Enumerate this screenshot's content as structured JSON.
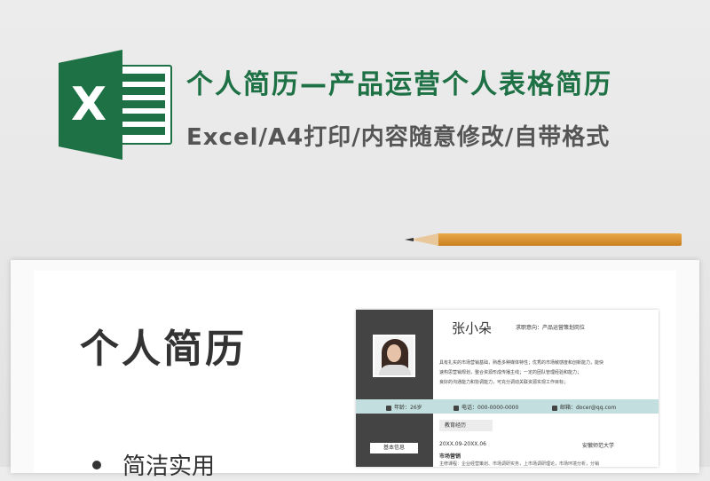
{
  "banner": {
    "title": "个人简历—产品运营个人表格简历",
    "subtitle": "Excel/A4打印/内容随意修改/自带格式",
    "logo_letter": "X",
    "brand_color": "#1e7145"
  },
  "slide": {
    "title": "个人简历",
    "bullet": "简洁实用"
  },
  "resume": {
    "name": "张小朵",
    "job_intent": "求职意向：产品运营策划岗位",
    "intro_lines": [
      "具有扎实的市场营销基础，熟悉多种媒体特性；优秀的市场敏感度和创新能力，能快",
      "速构思营销规划，整合资源形成传播主线；一定的团队管理经验和能力；",
      "良好的沟通能力和协调能力，可充分调动关联资源实现工作目标；"
    ],
    "age": "年龄：26岁",
    "phone": "电话：000-0000-0000",
    "email": "邮箱：docer@qq.com",
    "education_heading": "教育经历",
    "basic_info_heading": "基本信息",
    "edu_date": "20XX.09-20XX.06",
    "edu_school": "安徽师范大学",
    "edu_major": "市场营销",
    "edu_course": "主修课程：企业经营策划、市场调研实务，上市场调研理论，市场环境分析，分销"
  }
}
